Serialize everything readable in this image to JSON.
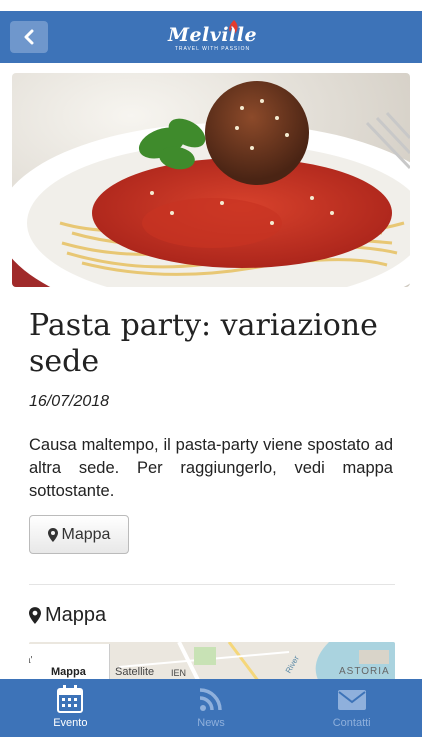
{
  "header": {
    "back_icon": "chevron-left-icon",
    "logo_text": "Melville",
    "logo_tagline": "TRAVEL WITH PASSION",
    "color": "#3d73b8"
  },
  "event": {
    "title": "Pasta party: variazione sede",
    "date": "16/07/2018",
    "description": "Causa maltempo, il pasta-party viene spostato ad altra sede. Per raggiungerlo, vedi mappa sottostante.",
    "map_button_label": "Mappa",
    "map_button_icon": "map-marker-icon"
  },
  "map_section": {
    "title": "Mappa",
    "icon": "map-marker-icon",
    "map_type_tabs": [
      "Mappa",
      "Satellite"
    ],
    "map_place_labels": [
      "IEN",
      "ASTORIA",
      "River"
    ]
  },
  "tabbar": {
    "tabs": [
      {
        "label": "Evento",
        "icon": "calendar-icon",
        "active": true
      },
      {
        "label": "News",
        "icon": "rss-icon",
        "active": false
      },
      {
        "label": "Contatti",
        "icon": "envelope-icon",
        "active": false
      }
    ]
  }
}
